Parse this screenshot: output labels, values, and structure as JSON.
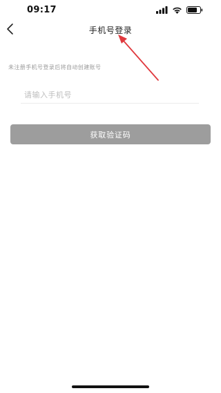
{
  "status_bar": {
    "time": "09:17",
    "icons": [
      "cellular-signal-icon",
      "wifi-icon",
      "battery-icon"
    ]
  },
  "nav": {
    "back_icon": "chevron-left-icon",
    "title": "手机号登录"
  },
  "annotation": {
    "type": "arrow",
    "color": "#e0393e"
  },
  "login": {
    "hint": "未注册手机号登录后将自动创建账号",
    "phone_placeholder": "请输入手机号",
    "phone_value": "",
    "get_code_label": "获取验证码",
    "button_color": "#9d9d9d"
  }
}
